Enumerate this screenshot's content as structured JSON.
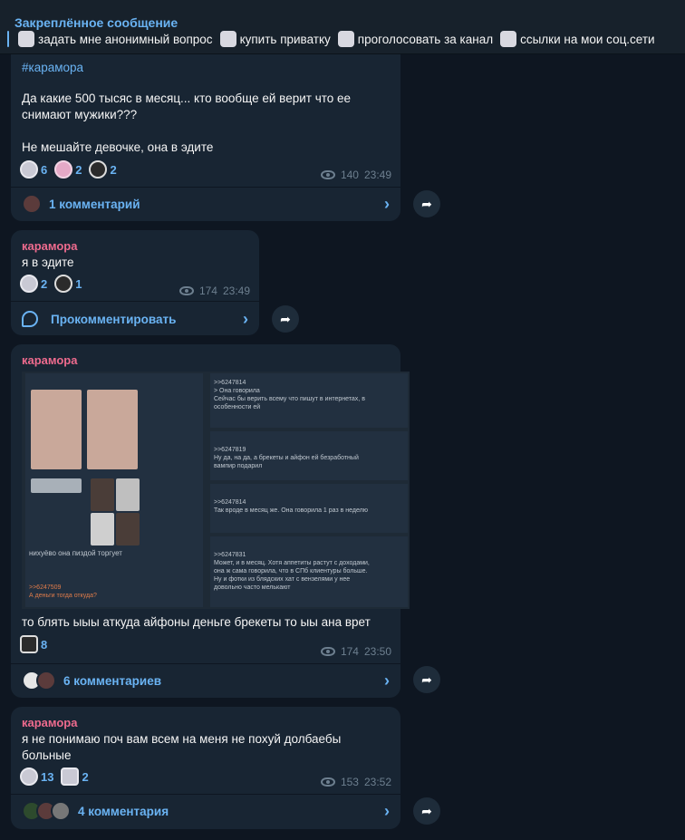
{
  "pinned": {
    "title": "Закреплённое сообщение",
    "items": [
      "задать мне анонимный вопрос",
      "купить приватку",
      "проголосовать за канал",
      "ссылки на мои соц.сети"
    ]
  },
  "posts": [
    {
      "hashtag": "#карамора",
      "text": "Да какие 500 тысяс в месяц... кто вообще ей верит что ее\nснимают мужики???\n\nНе мешайте девочке, она в эдите",
      "reactions": [
        "6",
        "2",
        "2"
      ],
      "views": "140",
      "time": "23:49",
      "comments_label": "1 комментарий"
    },
    {
      "author": "карамора",
      "text": "я в эдите",
      "reactions": [
        "2",
        "1"
      ],
      "views": "174",
      "time": "23:49",
      "comments_label": "Прокомментировать"
    },
    {
      "author": "карамора",
      "text": "то блять ыыы аткуда айфоны деньге брекеты то ыы ана врет",
      "reactions": [
        "8"
      ],
      "views": "174",
      "time": "23:50",
      "comments_label": "6 комментариев",
      "screenshot": {
        "left_caption": "нихуёво она пиздой торгует",
        "left_reply": ">>6247509\nА деньги тогда откуда?",
        "r1": ">>6247814\n> Она говорила\nСейчас бы верить всему что пишут в интернетах, в\nособенности ей",
        "r2": ">>6247819\nНу да, на да, а брекеты и айфон ей безработный\nвампир подарил",
        "r3": ">>6247814\nТак вроде в месяц же. Она говорила 1 раз в неделю",
        "r4": ">>6247831\nМожет, и в месяц. Хотя аппетиты растут с доходами,\nона ж сама говорила, что в СПб клиентуры больше.\nНу и фотки из блядских хат с вензелями у нее\nдовольно часто мелькают"
      }
    },
    {
      "author": "карамора",
      "text": "я не понимаю поч вам всем на меня не похуй долбаебы\nбольные",
      "reactions": [
        "13",
        "2"
      ],
      "views": "153",
      "time": "23:52",
      "comments_label": "4 комментария"
    }
  ]
}
